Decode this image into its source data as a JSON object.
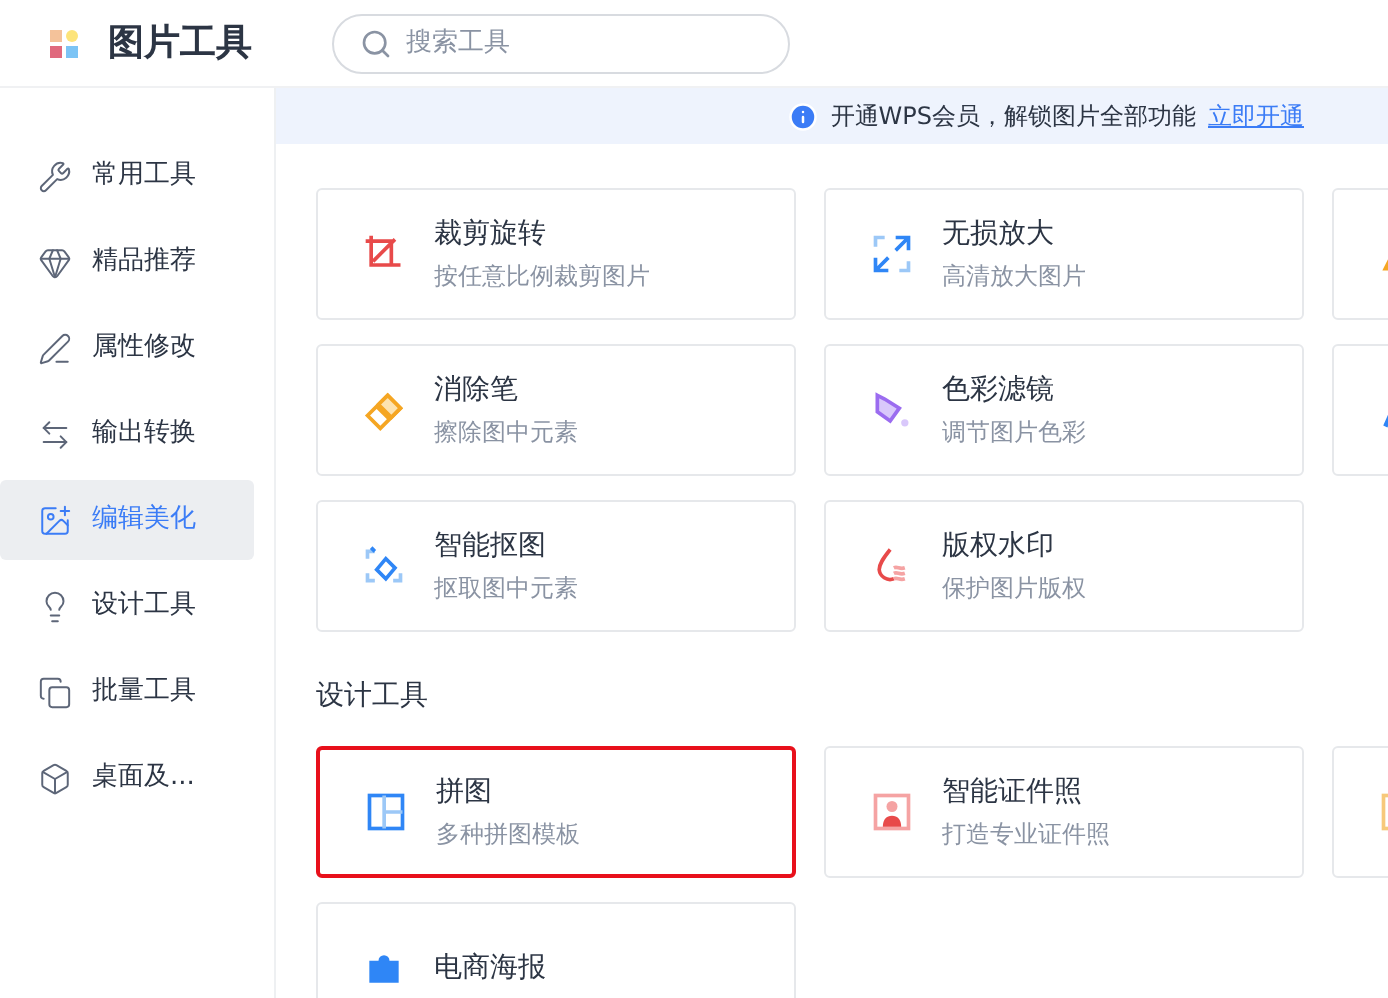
{
  "app": {
    "title": "图片工具"
  },
  "search": {
    "placeholder": "搜索工具"
  },
  "sidebar": {
    "items": [
      {
        "label": "常用工具",
        "selected": false
      },
      {
        "label": "精品推荐",
        "selected": false
      },
      {
        "label": "属性修改",
        "selected": false
      },
      {
        "label": "输出转换",
        "selected": false
      },
      {
        "label": "编辑美化",
        "selected": true
      },
      {
        "label": "设计工具",
        "selected": false
      },
      {
        "label": "批量工具",
        "selected": false
      },
      {
        "label": "桌面及...",
        "selected": false
      }
    ]
  },
  "banner": {
    "text": "开通WPS会员，解锁图片全部功能",
    "link": "立即开通"
  },
  "sections": [
    {
      "tools": [
        {
          "kind": "tool",
          "name": "裁剪旋转",
          "desc": "按任意比例裁剪图片",
          "highlighted": false
        },
        {
          "kind": "tool",
          "name": "无损放大",
          "desc": "高清放大图片",
          "highlighted": false
        },
        {
          "kind": "cut_off"
        },
        {
          "kind": "tool",
          "name": "消除笔",
          "desc": "擦除图中元素",
          "highlighted": false
        },
        {
          "kind": "tool",
          "name": "色彩滤镜",
          "desc": "调节图片色彩",
          "highlighted": false
        },
        {
          "kind": "cut_off"
        },
        {
          "kind": "tool",
          "name": "智能抠图",
          "desc": "抠取图中元素",
          "highlighted": false
        },
        {
          "kind": "tool",
          "name": "版权水印",
          "desc": "保护图片版权",
          "highlighted": false
        }
      ]
    },
    {
      "title": "设计工具",
      "tools": [
        {
          "kind": "tool",
          "name": "拼图",
          "desc": "多种拼图模板",
          "highlighted": true
        },
        {
          "kind": "tool",
          "name": "智能证件照",
          "desc": "打造专业证件照",
          "highlighted": false
        },
        {
          "kind": "cut_off"
        },
        {
          "kind": "tool",
          "name": "电商海报",
          "highlighted": false
        }
      ]
    }
  ]
}
